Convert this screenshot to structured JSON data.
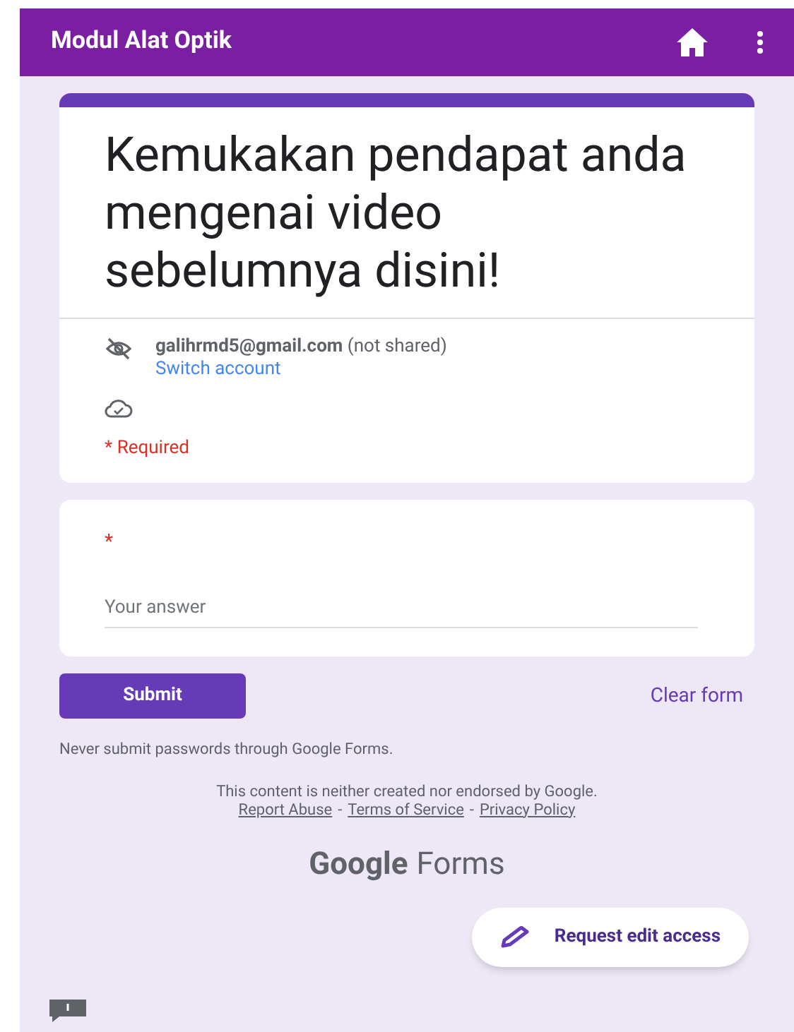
{
  "app_bar": {
    "title": "Modul Alat Optik"
  },
  "header_card": {
    "title": "Kemukakan pendapat anda mengenai video sebelumnya disini!",
    "account": "**galihrmd5@gmail.com** (not shared)",
    "switch_account": "Switch account",
    "required_note": "* Required"
  },
  "question": {
    "required_mark": "*",
    "placeholder": "Your answer"
  },
  "actions": {
    "submit": "Submit",
    "clear": "Clear form"
  },
  "warning": "Never submit passwords through Google Forms.",
  "disclaimer": "This content is neither created nor endorsed by Google.",
  "footer_links": [
    {
      "label": "Report Abuse"
    },
    {
      "label": "Terms of Service"
    },
    {
      "label": "Privacy Policy"
    }
  ],
  "separators": [
    "-",
    "-"
  ],
  "logo": {
    "brand": "Google",
    "product": "Forms"
  },
  "request_edit": "Request edit access"
}
